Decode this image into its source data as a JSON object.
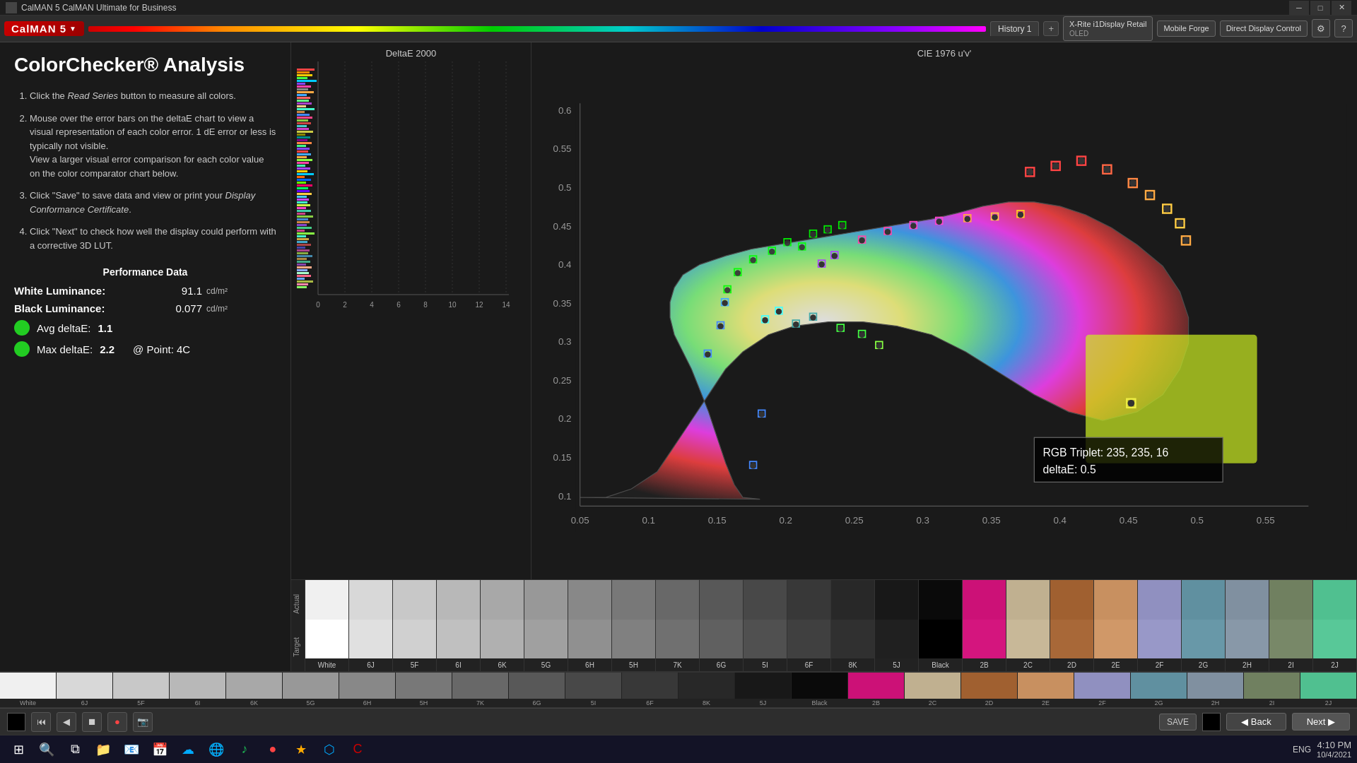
{
  "window": {
    "title": "CalMAN 5 CalMAN Ultimate for Business"
  },
  "toolbar": {
    "logo": "CalMAN 5",
    "history_tab": "History 1",
    "add_tab": "+",
    "device1_label": "X-Rite i1Display Retail",
    "device1_sub": "OLED",
    "device2_label": "Mobile Forge",
    "device3_label": "Direct Display Control",
    "gear_icon": "⚙",
    "question_icon": "?"
  },
  "page": {
    "title": "ColorChecker® Analysis",
    "instructions": [
      {
        "text": "Click the Read Series button to measure all colors."
      },
      {
        "text": "Mouse over the error bars on the deltaE chart to view a visual representation of each color error. 1 dE error or less is typically not visible. View a larger visual error comparison for each color value on the color comparator chart below."
      },
      {
        "text": "Click \"Save\" to save data and view or print your Display Conformance Certificate."
      },
      {
        "text": "Click \"Next\" to check how well the display could perform with a corrective 3D LUT."
      }
    ]
  },
  "performance": {
    "title": "Performance Data",
    "white_luminance_label": "White Luminance:",
    "white_luminance_value": "91.1",
    "white_luminance_unit": "cd/m²",
    "black_luminance_label": "Black Luminance:",
    "black_luminance_value": "0.077",
    "black_luminance_unit": "cd/m²",
    "avg_delta_label": "Avg deltaE:",
    "avg_delta_value": "1.1",
    "max_delta_label": "Max deltaE:",
    "max_delta_value": "2.2",
    "max_delta_point": "@ Point: 4C"
  },
  "deltae_chart": {
    "title": "DeltaE 2000",
    "x_labels": [
      "0",
      "2",
      "4",
      "6",
      "8",
      "10",
      "12",
      "14"
    ]
  },
  "cie_chart": {
    "title": "CIE 1976 u'v'",
    "tooltip_rgb": "RGB Triplet: 235, 235, 16",
    "tooltip_delta": "deltaE: 0.5",
    "y_labels": [
      "0.6",
      "0.55",
      "0.5",
      "0.45",
      "0.4",
      "0.35",
      "0.3",
      "0.25",
      "0.2",
      "0.15",
      "0.1"
    ],
    "x_labels": [
      "0.05",
      "0.1",
      "0.15",
      "0.2",
      "0.25",
      "0.3",
      "0.35",
      "0.4",
      "0.45",
      "0.5",
      "0.55"
    ]
  },
  "swatches": [
    {
      "name": "White",
      "actual": "#f0f0f0",
      "target": "#ffffff"
    },
    {
      "name": "6J",
      "actual": "#d8d8d8",
      "target": "#e0e0e0"
    },
    {
      "name": "5F",
      "actual": "#c8c8c8",
      "target": "#d0d0d0"
    },
    {
      "name": "6I",
      "actual": "#b8b8b8",
      "target": "#c0c0c0"
    },
    {
      "name": "6K",
      "actual": "#a8a8a8",
      "target": "#b0b0b0"
    },
    {
      "name": "5G",
      "actual": "#989898",
      "target": "#a0a0a0"
    },
    {
      "name": "6H",
      "actual": "#888888",
      "target": "#909090"
    },
    {
      "name": "5H",
      "actual": "#787878",
      "target": "#808080"
    },
    {
      "name": "7K",
      "actual": "#686868",
      "target": "#707070"
    },
    {
      "name": "6G",
      "actual": "#585858",
      "target": "#606060"
    },
    {
      "name": "5I",
      "actual": "#484848",
      "target": "#505050"
    },
    {
      "name": "6F",
      "actual": "#383838",
      "target": "#404040"
    },
    {
      "name": "8K",
      "actual": "#282828",
      "target": "#303030"
    },
    {
      "name": "5J",
      "actual": "#181818",
      "target": "#202020"
    },
    {
      "name": "Black",
      "actual": "#0a0a0a",
      "target": "#000000"
    },
    {
      "name": "2B",
      "actual": "#cc1177",
      "target": "#d4157e"
    },
    {
      "name": "2C",
      "actual": "#c0b090",
      "target": "#c8b898"
    },
    {
      "name": "2D",
      "actual": "#a06030",
      "target": "#a86838"
    },
    {
      "name": "2E",
      "actual": "#c89060",
      "target": "#d09868"
    },
    {
      "name": "2F",
      "actual": "#9090c0",
      "target": "#9898c8"
    },
    {
      "name": "2G",
      "actual": "#6090a0",
      "target": "#6898a8"
    },
    {
      "name": "2H",
      "actual": "#8090a0",
      "target": "#8898a8"
    },
    {
      "name": "2I",
      "actual": "#708060",
      "target": "#788868"
    },
    {
      "name": "2J",
      "actual": "#50c090",
      "target": "#58c898"
    }
  ],
  "nav": {
    "back_label": "Back",
    "next_label": "Next",
    "save_label": "SAVE"
  },
  "taskbar": {
    "time": "4:10 PM",
    "date": "10/4/2021",
    "lang": "ENG"
  }
}
